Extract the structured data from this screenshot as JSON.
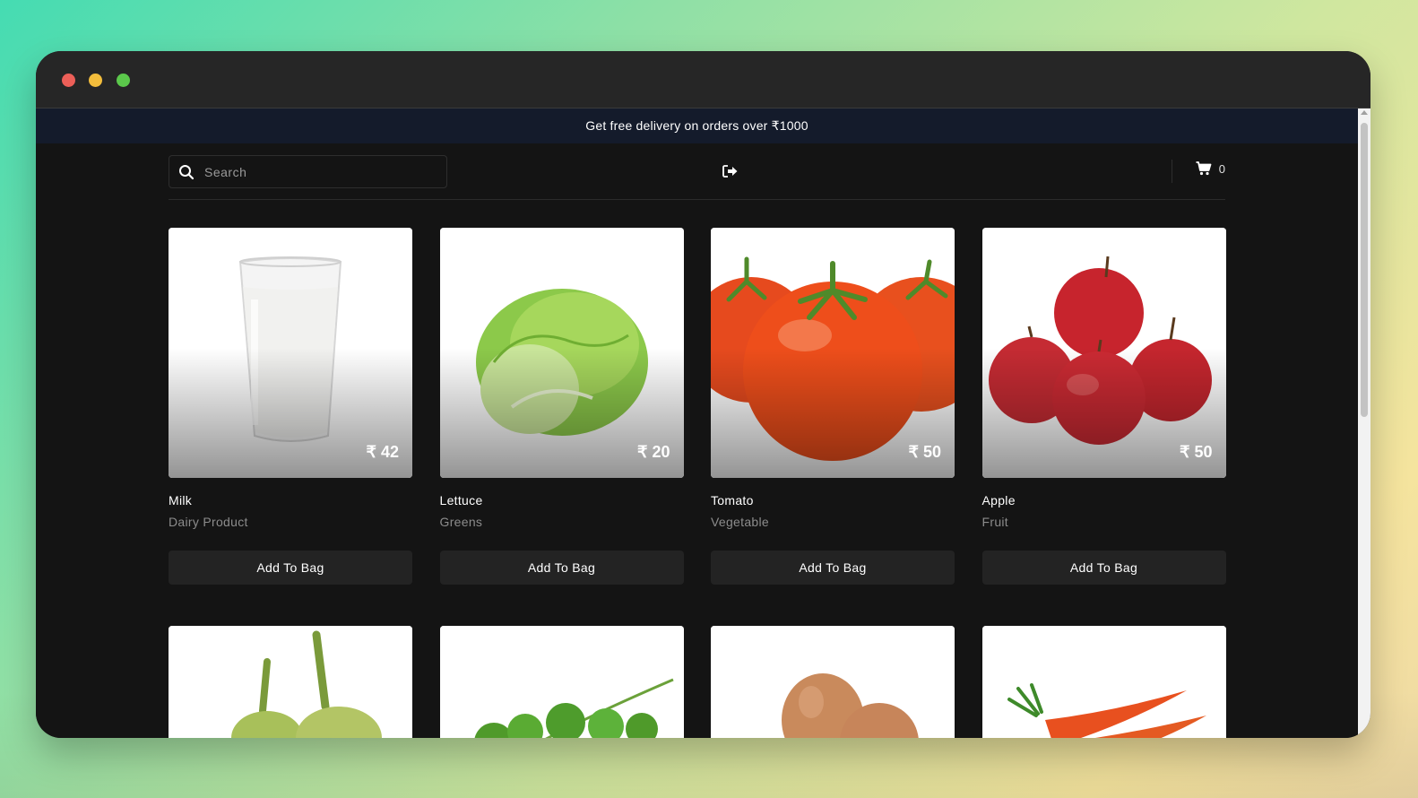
{
  "promo": {
    "text": "Get free delivery on orders over ₹1000"
  },
  "search": {
    "placeholder": "Search"
  },
  "cart": {
    "count": "0"
  },
  "products": [
    {
      "name": "Milk",
      "category": "Dairy Product",
      "price": "₹ 42",
      "button": "Add To Bag",
      "image": "milk-glass"
    },
    {
      "name": "Lettuce",
      "category": "Greens",
      "price": "₹ 20",
      "button": "Add To Bag",
      "image": "lettuce-head"
    },
    {
      "name": "Tomato",
      "category": "Vegetable",
      "price": "₹ 50",
      "button": "Add To Bag",
      "image": "tomatoes"
    },
    {
      "name": "Apple",
      "category": "Fruit",
      "price": "₹ 50",
      "button": "Add To Bag",
      "image": "apples"
    }
  ],
  "products_row2_images": [
    "eggplant",
    "coriander",
    "eggs",
    "carrots"
  ],
  "colors": {
    "page_bg": "#141414",
    "promo_bg": "#141b2b",
    "button_bg": "#232323",
    "muted_text": "#8c8c8c"
  }
}
